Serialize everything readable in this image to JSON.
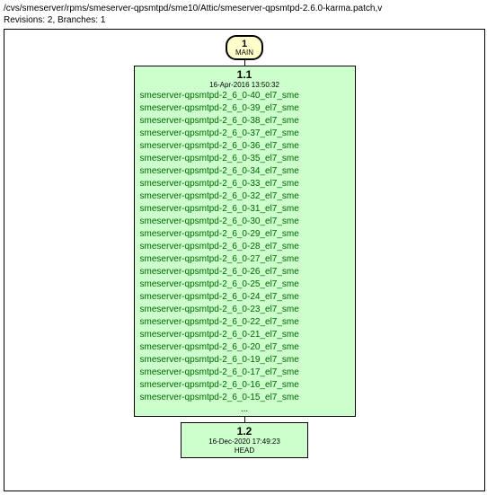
{
  "breadcrumb": "/cvs/smeserver/rpms/smeserver-qpsmtpd/sme10/Attic/smeserver-qpsmtpd-2.6.0-karma.patch,v",
  "revisions_info": "Revisions: 2, Branches: 1",
  "branch": {
    "number": "1",
    "label": "MAIN"
  },
  "rev1": {
    "version": "1.1",
    "date": "16-Apr-2016 13:50:32",
    "tags": [
      "smeserver-qpsmtpd-2_6_0-40_el7_sme",
      "smeserver-qpsmtpd-2_6_0-39_el7_sme",
      "smeserver-qpsmtpd-2_6_0-38_el7_sme",
      "smeserver-qpsmtpd-2_6_0-37_el7_sme",
      "smeserver-qpsmtpd-2_6_0-36_el7_sme",
      "smeserver-qpsmtpd-2_6_0-35_el7_sme",
      "smeserver-qpsmtpd-2_6_0-34_el7_sme",
      "smeserver-qpsmtpd-2_6_0-33_el7_sme",
      "smeserver-qpsmtpd-2_6_0-32_el7_sme",
      "smeserver-qpsmtpd-2_6_0-31_el7_sme",
      "smeserver-qpsmtpd-2_6_0-30_el7_sme",
      "smeserver-qpsmtpd-2_6_0-29_el7_sme",
      "smeserver-qpsmtpd-2_6_0-28_el7_sme",
      "smeserver-qpsmtpd-2_6_0-27_el7_sme",
      "smeserver-qpsmtpd-2_6_0-26_el7_sme",
      "smeserver-qpsmtpd-2_6_0-25_el7_sme",
      "smeserver-qpsmtpd-2_6_0-24_el7_sme",
      "smeserver-qpsmtpd-2_6_0-23_el7_sme",
      "smeserver-qpsmtpd-2_6_0-22_el7_sme",
      "smeserver-qpsmtpd-2_6_0-21_el7_sme",
      "smeserver-qpsmtpd-2_6_0-20_el7_sme",
      "smeserver-qpsmtpd-2_6_0-19_el7_sme",
      "smeserver-qpsmtpd-2_6_0-17_el7_sme",
      "smeserver-qpsmtpd-2_6_0-16_el7_sme",
      "smeserver-qpsmtpd-2_6_0-15_el7_sme"
    ],
    "ellipsis": "..."
  },
  "rev2": {
    "version": "1.2",
    "date": "16-Dec-2020 17:49:23",
    "head": "HEAD"
  }
}
